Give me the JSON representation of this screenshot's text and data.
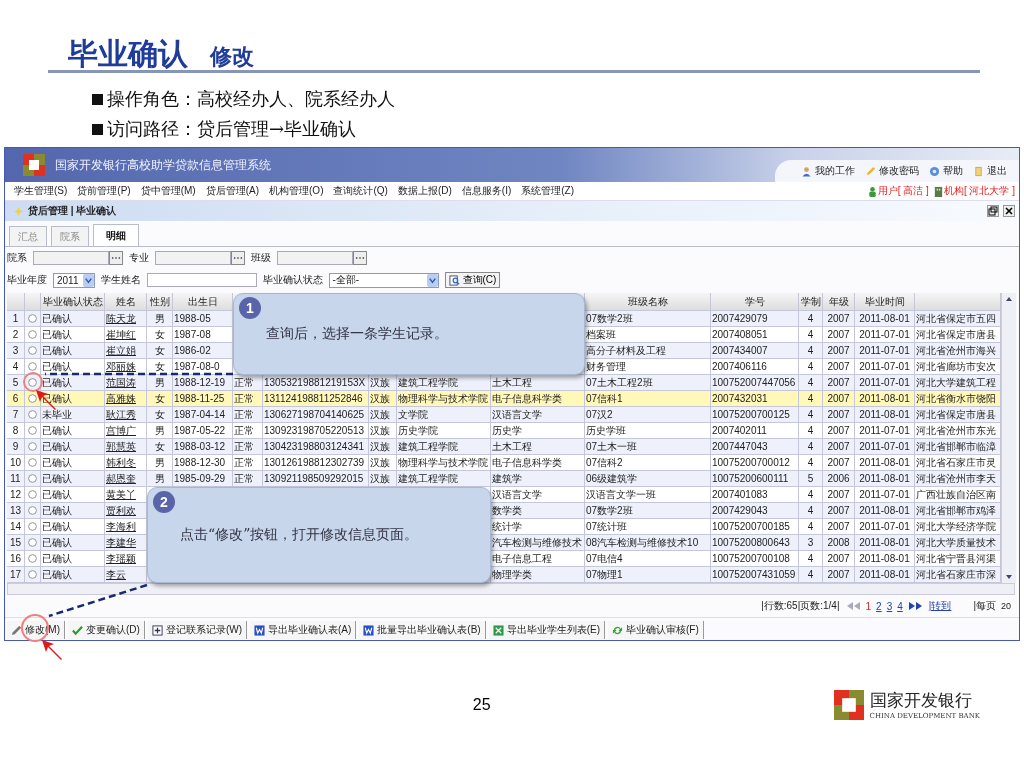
{
  "slide": {
    "title": "毕业确认",
    "subtitle": "修改",
    "bullets": [
      "操作角色：高校经办人、院系经办人",
      "访问路径：贷后管理→毕业确认"
    ],
    "page_number": "25",
    "bank_name": "国家开发银行",
    "bank_name_en": "CHINA DEVELOPMENT BANK"
  },
  "app": {
    "title": "国家开发银行高校助学贷款信息管理系统",
    "top_links": [
      {
        "label": "我的工作",
        "kind": "work"
      },
      {
        "label": "修改密码",
        "kind": "password"
      },
      {
        "label": "帮助",
        "kind": "help"
      },
      {
        "label": "退出",
        "kind": "exit"
      }
    ],
    "user": "用户[ 高洁 ]",
    "org": "机构[ 河北大学 ]",
    "menu": [
      "学生管理(S)",
      "贷前管理(P)",
      "贷中管理(M)",
      "贷后管理(A)",
      "机构管理(O)",
      "查询统计(Q)",
      "数据上报(D)",
      "信息服务(I)",
      "系统管理(Z)"
    ],
    "breadcrumb": "贷后管理 | 毕业确认",
    "tabs": [
      {
        "label": "汇总",
        "selected": false
      },
      {
        "label": "院系",
        "selected": false
      },
      {
        "label": "明细",
        "selected": true
      }
    ],
    "filters": {
      "department_label": "院系",
      "major_label": "专业",
      "class_label": "班级",
      "year_label": "毕业年度",
      "year_value": "2011",
      "name_label": "学生姓名",
      "status_label": "毕业确认状态",
      "status_value": "-全部-",
      "query_button": "查询(C)"
    },
    "table": {
      "columns": [
        "毕业确认状态",
        "姓名",
        "性别",
        "出生日",
        null,
        null,
        null,
        null,
        null,
        "班级名称",
        "学号",
        "学制",
        "年级",
        "毕业时间",
        null
      ],
      "rows": [
        {
          "number": "1",
          "checked": false,
          "selected": false,
          "cells": [
            "已确认",
            "陈天龙",
            "男",
            "1988-05",
            null,
            null,
            null,
            null,
            null,
            "07数学2班",
            "2007429079",
            "4",
            "2007",
            "2011-08-01",
            "河北省保定市五四"
          ]
        },
        {
          "number": "2",
          "checked": false,
          "selected": false,
          "cells": [
            "已确认",
            "崔坤红",
            "女",
            "1987-08",
            null,
            null,
            null,
            null,
            null,
            "档案班",
            "2007408051",
            "4",
            "2007",
            "2011-07-01",
            "河北省保定市唐县"
          ]
        },
        {
          "number": "3",
          "checked": false,
          "selected": false,
          "cells": [
            "已确认",
            "崔立娟",
            "女",
            "1986-02",
            null,
            null,
            null,
            null,
            null,
            "高分子材料及工程",
            "2007434007",
            "4",
            "2007",
            "2011-07-01",
            "河北省沧州市海兴"
          ]
        },
        {
          "number": "4",
          "checked": false,
          "selected": false,
          "cells": [
            "已确认",
            "邓丽姝",
            "女",
            "1987-08-0",
            null,
            null,
            null,
            null,
            null,
            "财务管理",
            "2007406116",
            "4",
            "2007",
            "2011-07-01",
            "河北省廊坊市安次"
          ]
        },
        {
          "number": "5",
          "checked": false,
          "selected": false,
          "cells": [
            "已确认",
            "范国涛",
            "男",
            "1988-12-19",
            "正常",
            "13053219881219153X",
            "汉族",
            "建筑工程学院",
            "土木工程",
            "07土木工程2班",
            "100752007447056",
            "4",
            "2007",
            "2011-07-01",
            "河北大学建筑工程"
          ]
        },
        {
          "number": "6",
          "checked": false,
          "selected": true,
          "cells": [
            "已确认",
            "高雅姝",
            "女",
            "1988-11-25",
            "正常",
            "131124198811252846",
            "汉族",
            "物理科学与技术学院",
            "电子信息科学类",
            "07信科1",
            "2007432031",
            "4",
            "2007",
            "2011-08-01",
            "河北省衡水市饶阳"
          ]
        },
        {
          "number": "7",
          "checked": false,
          "selected": false,
          "cells": [
            "未毕业",
            "耿江秀",
            "女",
            "1987-04-14",
            "正常",
            "130627198704140625",
            "汉族",
            "文学院",
            "汉语言文学",
            "07汉2",
            "10075200700125",
            "4",
            "2007",
            "2011-08-01",
            "河北省保定市唐县"
          ]
        },
        {
          "number": "8",
          "checked": false,
          "selected": false,
          "cells": [
            "已确认",
            "宫博广",
            "男",
            "1987-05-22",
            "正常",
            "130923198705220513",
            "汉族",
            "历史学院",
            "历史学",
            "历史学班",
            "2007402011",
            "4",
            "2007",
            "2011-07-01",
            "河北省沧州市东光"
          ]
        },
        {
          "number": "9",
          "checked": false,
          "selected": false,
          "cells": [
            "已确认",
            "郭慧英",
            "女",
            "1988-03-12",
            "正常",
            "130423198803124341",
            "汉族",
            "建筑工程学院",
            "土木工程",
            "07土木一班",
            "2007447043",
            "4",
            "2007",
            "2011-07-01",
            "河北省邯郸市临漳"
          ]
        },
        {
          "number": "10",
          "checked": false,
          "selected": false,
          "cells": [
            "已确认",
            "韩利冬",
            "男",
            "1988-12-30",
            "正常",
            "130126198812302739",
            "汉族",
            "物理科学与技术学院",
            "电子信息科学类",
            "07信科2",
            "10075200700012",
            "4",
            "2007",
            "2011-08-01",
            "河北省石家庄市灵"
          ]
        },
        {
          "number": "11",
          "checked": false,
          "selected": false,
          "cells": [
            "已确认",
            "郝恩奎",
            "男",
            "1985-09-29",
            "正常",
            "130921198509292015",
            "汉族",
            "建筑工程学院",
            "建筑学",
            "06级建筑学",
            "10075200600111",
            "5",
            "2006",
            "2011-08-01",
            "河北省沧州市李天"
          ]
        },
        {
          "number": "12",
          "checked": false,
          "selected": false,
          "cells": [
            "已确认",
            "黄美丫",
            null,
            null,
            null,
            null,
            null,
            null,
            "汉语言文学",
            "汉语言文学一班",
            "2007401083",
            "4",
            "2007",
            "2011-07-01",
            "广西壮族自治区南"
          ]
        },
        {
          "number": "13",
          "checked": false,
          "selected": false,
          "cells": [
            "已确认",
            "贾利欢",
            null,
            null,
            null,
            null,
            null,
            null,
            "数学类",
            "07数学2班",
            "2007429043",
            "4",
            "2007",
            "2011-08-01",
            "河北省邯郸市鸡泽"
          ]
        },
        {
          "number": "14",
          "checked": false,
          "selected": false,
          "cells": [
            "已确认",
            "李海利",
            null,
            null,
            null,
            null,
            null,
            null,
            "统计学",
            "07统计班",
            "10075200700185",
            "4",
            "2007",
            "2011-07-01",
            "河北大学经济学院"
          ]
        },
        {
          "number": "15",
          "checked": false,
          "selected": false,
          "cells": [
            "已确认",
            "李建华",
            null,
            null,
            null,
            null,
            null,
            null,
            "汽车检测与维修技术",
            "08汽车检测与维修技术10",
            "10075200800643",
            "3",
            "2008",
            "2011-08-01",
            "河北大学质量技术"
          ]
        },
        {
          "number": "16",
          "checked": false,
          "selected": false,
          "cells": [
            "已确认",
            "李瑶颖",
            null,
            null,
            null,
            null,
            null,
            null,
            "电子信息工程",
            "07电信4",
            "10075200700108",
            "4",
            "2007",
            "2011-08-01",
            "河北省宁晋县河渠"
          ]
        },
        {
          "number": "17",
          "checked": false,
          "selected": false,
          "cells": [
            "已确认",
            "李云",
            null,
            null,
            null,
            null,
            null,
            null,
            "物理学类",
            "07物理1",
            "100752007431059",
            "4",
            "2007",
            "2011-08-01",
            "河北省石家庄市深"
          ]
        }
      ]
    },
    "pagination": {
      "summary": "|行数:65|页数:1/4|",
      "pages": [
        {
          "label": "1",
          "selected": true
        },
        {
          "label": "2",
          "selected": false
        },
        {
          "label": "3",
          "selected": false
        },
        {
          "label": "4",
          "selected": false
        }
      ],
      "goto": "|转到",
      "per_page_label": "|每页",
      "per_page_value": "20"
    },
    "toolbar": [
      {
        "label": "修改(M)",
        "kind": "edit"
      },
      {
        "label": "变更确认(D)",
        "kind": "confirm"
      },
      {
        "label": "登记联系记录(W)",
        "kind": "add"
      },
      {
        "label": "导出毕业确认表(A)",
        "kind": "word"
      },
      {
        "label": "批量导出毕业确认表(B)",
        "kind": "word"
      },
      {
        "label": "导出毕业学生列表(E)",
        "kind": "excel"
      },
      {
        "label": "毕业确认审核(F)",
        "kind": "review"
      }
    ]
  },
  "callouts": [
    {
      "number": "1",
      "text": "查询后，选择一条学生记录。"
    },
    {
      "number": "2",
      "text": "点击“修改”按钮，打开修改信息页面。"
    }
  ]
}
